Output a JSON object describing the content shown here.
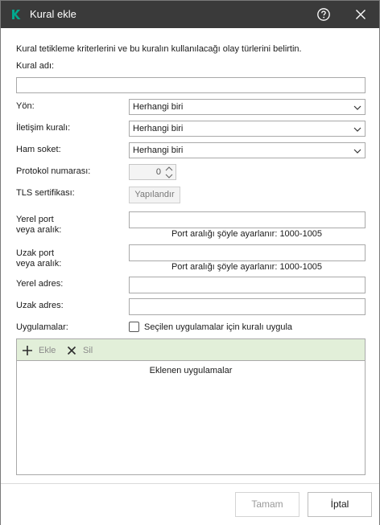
{
  "window": {
    "title": "Kural ekle"
  },
  "description": "Kural tetikleme kriterlerini ve bu kuralın kullanılacağı olay türlerini belirtin.",
  "form": {
    "rule_name_label": "Kural adı:",
    "rule_name_value": "",
    "direction_label": "Yön:",
    "direction_value": "Herhangi biri",
    "protocol_label": "İletişim kuralı:",
    "protocol_value": "Herhangi biri",
    "raw_socket_label": "Ham soket:",
    "raw_socket_value": "Herhangi biri",
    "protocol_number_label": "Protokol numarası:",
    "protocol_number_value": "0",
    "tls_label": "TLS sertifikası:",
    "tls_button": "Yapılandır",
    "local_port_label_1": "Yerel port",
    "local_port_label_2": "veya aralık:",
    "local_port_value": "",
    "local_port_hint": "Port aralığı şöyle ayarlanır: 1000-1005",
    "remote_port_label_1": "Uzak port",
    "remote_port_label_2": "veya aralık:",
    "remote_port_value": "",
    "remote_port_hint": "Port aralığı şöyle ayarlanır: 1000-1005",
    "local_address_label": "Yerel adres:",
    "local_address_value": "",
    "remote_address_label": "Uzak adres:",
    "remote_address_value": "",
    "apps_label": "Uygulamalar:",
    "apps_checkbox_label": "Seçilen uygulamalar için kuralı uygula",
    "apps_checkbox_checked": false
  },
  "apps_toolbar": {
    "add_label": "Ekle",
    "delete_label": "Sil"
  },
  "apps_list": {
    "header": "Eklenen uygulamalar"
  },
  "footer": {
    "ok_label": "Tamam",
    "cancel_label": "İptal"
  },
  "colors": {
    "titlebar": "#3a3a3a",
    "logo": "#00a88e",
    "toolbar_bg": "#e2efd9"
  }
}
